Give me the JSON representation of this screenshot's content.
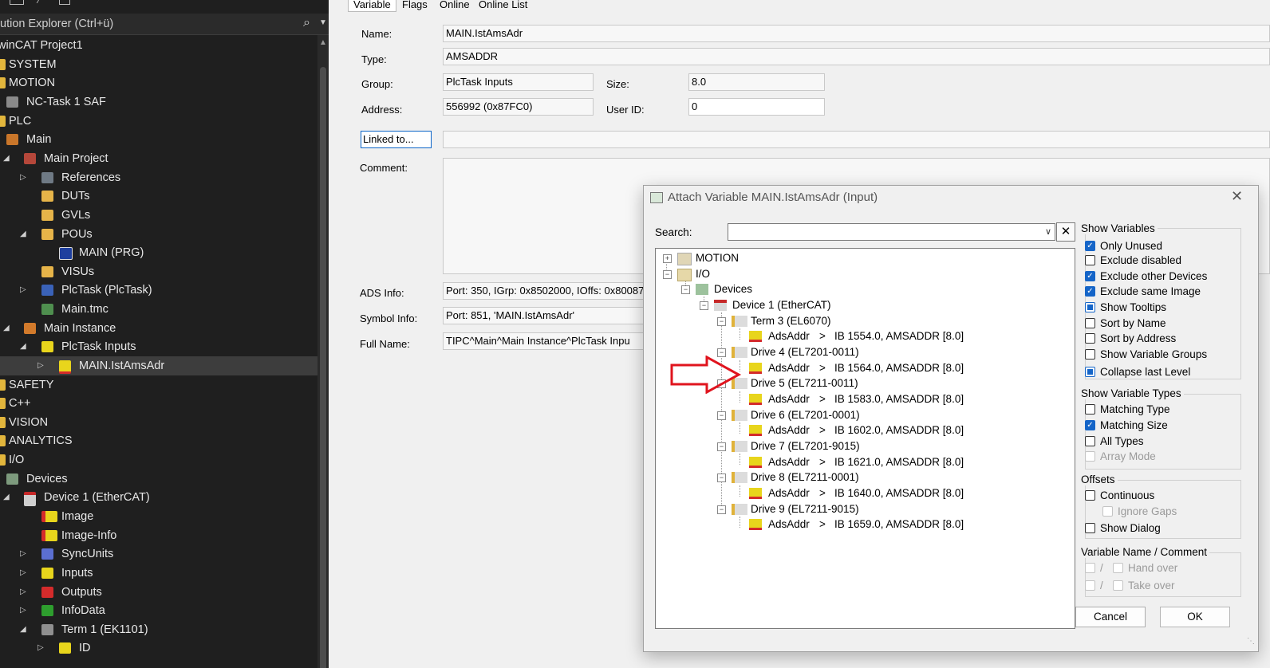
{
  "explorer": {
    "search_text": "ution Explorer (Ctrl+ü)",
    "items": [
      {
        "label": "winCAT Project1"
      },
      {
        "label": "SYSTEM"
      },
      {
        "label": "MOTION"
      },
      {
        "label": "NC-Task 1 SAF"
      },
      {
        "label": "PLC"
      },
      {
        "label": "Main"
      },
      {
        "label": "Main Project"
      },
      {
        "label": "References"
      },
      {
        "label": "DUTs"
      },
      {
        "label": "GVLs"
      },
      {
        "label": "POUs"
      },
      {
        "label": "MAIN (PRG)"
      },
      {
        "label": "VISUs"
      },
      {
        "label": "PlcTask (PlcTask)"
      },
      {
        "label": "Main.tmc"
      },
      {
        "label": "Main Instance"
      },
      {
        "label": "PlcTask Inputs"
      },
      {
        "label": "MAIN.IstAmsAdr"
      },
      {
        "label": "SAFETY"
      },
      {
        "label": "C++"
      },
      {
        "label": "VISION"
      },
      {
        "label": "ANALYTICS"
      },
      {
        "label": "I/O"
      },
      {
        "label": "Devices"
      },
      {
        "label": "Device 1 (EtherCAT)"
      },
      {
        "label": "Image"
      },
      {
        "label": "Image-Info"
      },
      {
        "label": "SyncUnits"
      },
      {
        "label": "Inputs"
      },
      {
        "label": "Outputs"
      },
      {
        "label": "InfoData"
      },
      {
        "label": "Term 1 (EK1101)"
      },
      {
        "label": "ID"
      }
    ]
  },
  "props": {
    "tabs": [
      "Variable",
      "Flags",
      "Online",
      "Online List"
    ],
    "name_label": "Name:",
    "name_value": "MAIN.IstAmsAdr",
    "type_label": "Type:",
    "type_value": "AMSADDR",
    "group_label": "Group:",
    "group_value": "PlcTask Inputs",
    "size_label": "Size:",
    "size_value": "8.0",
    "address_label": "Address:",
    "address_value": "556992 (0x87FC0)",
    "userid_label": "User ID:",
    "userid_value": "0",
    "linked_label": "Linked to...",
    "comment_label": "Comment:",
    "adsinfo_label": "ADS Info:",
    "adsinfo_value": "Port: 350, IGrp: 0x8502000, IOffs: 0x80087",
    "symbolinfo_label": "Symbol Info:",
    "symbolinfo_value": "Port: 851, 'MAIN.IstAmsAdr'",
    "fullname_label": "Full Name:",
    "fullname_value": "TIPC^Main^Main Instance^PlcTask Inpu"
  },
  "dialog": {
    "title": "Attach Variable MAIN.IstAmsAdr (Input)",
    "search_label": "Search:",
    "search_value": "",
    "clear_label": "✕",
    "tree": {
      "motion": "MOTION",
      "io": "I/O",
      "devices": "Devices",
      "device1": "Device 1 (EtherCAT)",
      "terms": [
        {
          "name": "Term 3 (EL6070)",
          "var": "AdsAddr",
          "sep": ">",
          "addr": "IB 1554.0, AMSADDR [8.0]"
        },
        {
          "name": "Drive 4 (EL7201-0011)",
          "var": "AdsAddr",
          "sep": ">",
          "addr": "IB 1564.0, AMSADDR [8.0]"
        },
        {
          "name": "Drive 5 (EL7211-0011)",
          "var": "AdsAddr",
          "sep": ">",
          "addr": "IB 1583.0, AMSADDR [8.0]"
        },
        {
          "name": "Drive 6 (EL7201-0001)",
          "var": "AdsAddr",
          "sep": ">",
          "addr": "IB 1602.0, AMSADDR [8.0]"
        },
        {
          "name": "Drive 7 (EL7201-9015)",
          "var": "AdsAddr",
          "sep": ">",
          "addr": "IB 1621.0, AMSADDR [8.0]"
        },
        {
          "name": "Drive 8 (EL7211-0001)",
          "var": "AdsAddr",
          "sep": ">",
          "addr": "IB 1640.0, AMSADDR [8.0]"
        },
        {
          "name": "Drive 9 (EL7211-9015)",
          "var": "AdsAddr",
          "sep": ">",
          "addr": "IB 1659.0, AMSADDR [8.0]"
        }
      ]
    },
    "show_variables": {
      "title": "Show Variables",
      "items": [
        {
          "label": "Only Unused",
          "state": "checked"
        },
        {
          "label": "Exclude disabled",
          "state": "unchecked"
        },
        {
          "label": "Exclude other Devices",
          "state": "checked"
        },
        {
          "label": "Exclude same Image",
          "state": "checked"
        },
        {
          "label": "Show Tooltips",
          "state": "indeterminate"
        },
        {
          "label": "Sort by Name",
          "state": "unchecked"
        },
        {
          "label": "Sort by Address",
          "state": "unchecked"
        },
        {
          "label": "Show Variable Groups",
          "state": "unchecked"
        },
        {
          "label": "Collapse last Level",
          "state": "indeterminate"
        }
      ]
    },
    "show_types": {
      "title": "Show Variable Types",
      "items": [
        {
          "label": "Matching Type",
          "state": "unchecked"
        },
        {
          "label": "Matching Size",
          "state": "checked"
        },
        {
          "label": "All Types",
          "state": "unchecked"
        },
        {
          "label": "Array Mode",
          "state": "disabled"
        }
      ]
    },
    "offsets": {
      "title": "Offsets",
      "continuous": "Continuous",
      "ignore_gaps": "Ignore Gaps",
      "show_dialog": "Show Dialog"
    },
    "varname": {
      "title": "Variable Name / Comment",
      "slash": "/",
      "hand_over": "Hand over",
      "take_over": "Take over"
    },
    "cancel_label": "Cancel",
    "ok_label": "OK"
  },
  "colors": {
    "arrow": "#e0141e",
    "check_blue": "#1565c8"
  }
}
